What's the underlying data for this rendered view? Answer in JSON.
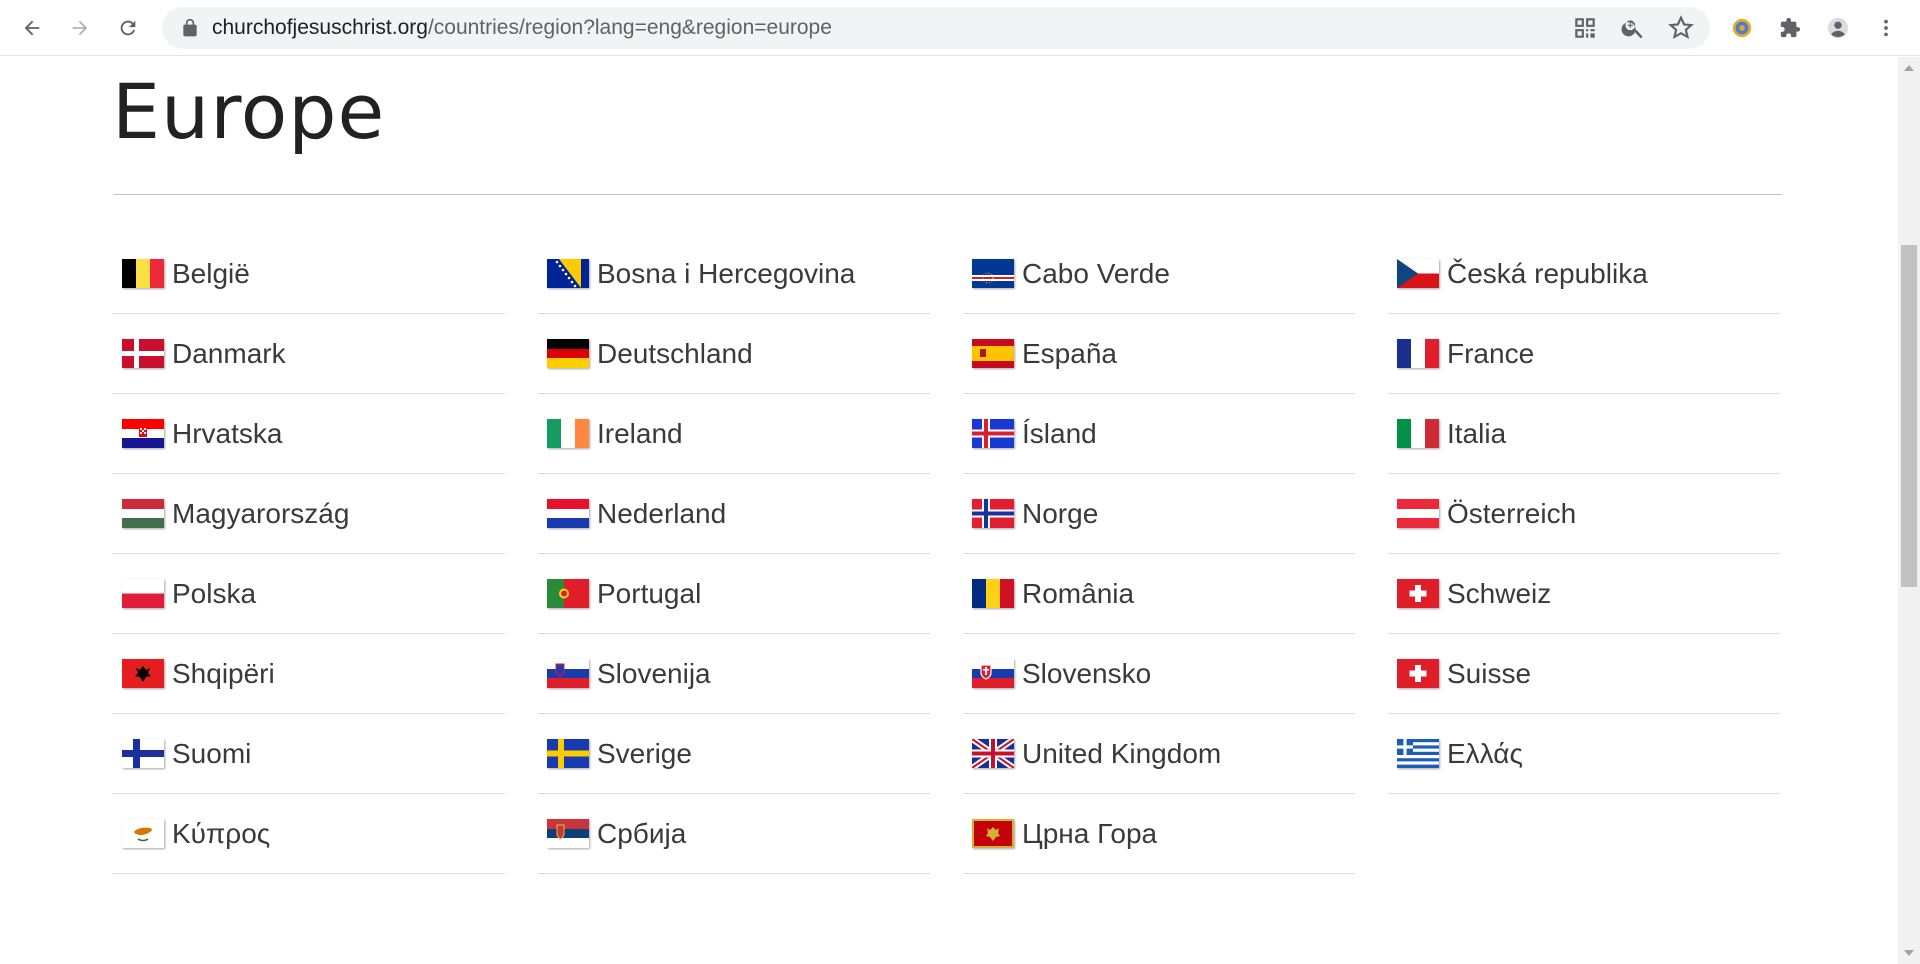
{
  "browser": {
    "url_host": "churchofjesuschrist.org",
    "url_path": "/countries/region?lang=eng&region=europe"
  },
  "page": {
    "title": "Europe"
  },
  "countries": [
    {
      "name": "België",
      "flag": "belgium-flag"
    },
    {
      "name": "Bosna i Hercegovina",
      "flag": "bosnia-flag"
    },
    {
      "name": "Cabo Verde",
      "flag": "cape-verde-flag"
    },
    {
      "name": "Česká republika",
      "flag": "czech-flag"
    },
    {
      "name": "Danmark",
      "flag": "denmark-flag"
    },
    {
      "name": "Deutschland",
      "flag": "germany-flag"
    },
    {
      "name": "España",
      "flag": "spain-flag"
    },
    {
      "name": "France",
      "flag": "france-flag"
    },
    {
      "name": "Hrvatska",
      "flag": "croatia-flag"
    },
    {
      "name": "Ireland",
      "flag": "ireland-flag"
    },
    {
      "name": "Ísland",
      "flag": "iceland-flag"
    },
    {
      "name": "Italia",
      "flag": "italy-flag"
    },
    {
      "name": "Magyarország",
      "flag": "hungary-flag"
    },
    {
      "name": "Nederland",
      "flag": "netherlands-flag"
    },
    {
      "name": "Norge",
      "flag": "norway-flag"
    },
    {
      "name": "Österreich",
      "flag": "austria-flag"
    },
    {
      "name": "Polska",
      "flag": "poland-flag"
    },
    {
      "name": "Portugal",
      "flag": "portugal-flag"
    },
    {
      "name": "România",
      "flag": "romania-flag"
    },
    {
      "name": "Schweiz",
      "flag": "switzerland-flag"
    },
    {
      "name": "Shqipëri",
      "flag": "albania-flag"
    },
    {
      "name": "Slovenija",
      "flag": "slovenia-flag"
    },
    {
      "name": "Slovensko",
      "flag": "slovakia-flag"
    },
    {
      "name": "Suisse",
      "flag": "switzerland-flag"
    },
    {
      "name": "Suomi",
      "flag": "finland-flag"
    },
    {
      "name": "Sverige",
      "flag": "sweden-flag"
    },
    {
      "name": "United Kingdom",
      "flag": "uk-flag"
    },
    {
      "name": "Ελλάς",
      "flag": "greece-flag"
    },
    {
      "name": "Κύπρος",
      "flag": "cyprus-flag"
    },
    {
      "name": "Србија",
      "flag": "serbia-flag"
    },
    {
      "name": "Црна Гора",
      "flag": "montenegro-flag"
    }
  ]
}
